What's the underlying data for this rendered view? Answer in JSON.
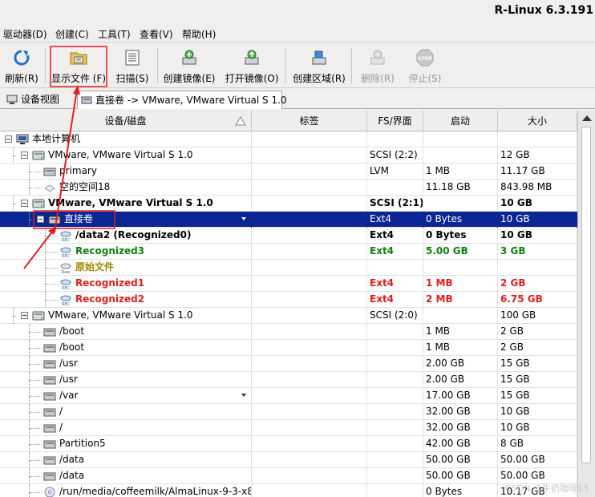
{
  "window": {
    "title": "R-Linux 6.3.191"
  },
  "menu": [
    "驱动器(D)",
    "创建(C)",
    "工具(T)",
    "查看(V)",
    "帮助(H)"
  ],
  "toolbar": [
    {
      "label": "刷新(R)",
      "icon": "refresh-icon",
      "enabled": true
    },
    {
      "label": "显示文件 (F)",
      "icon": "show-files-icon",
      "enabled": true
    },
    {
      "label": "扫描(S)",
      "icon": "scan-icon",
      "enabled": true
    },
    {
      "label": "创建镜像(E)",
      "icon": "create-image-icon",
      "enabled": true
    },
    {
      "label": "打开镜像(O)",
      "icon": "open-image-icon",
      "enabled": true
    },
    {
      "label": "创建区域(R)",
      "icon": "create-region-icon",
      "enabled": true
    },
    {
      "label": "删除(R)",
      "icon": "delete-icon",
      "enabled": false
    },
    {
      "label": "停止(S)",
      "icon": "stop-icon",
      "enabled": false
    }
  ],
  "tabs": [
    {
      "label": "设备视图",
      "icon": "device-view-icon"
    },
    {
      "label": "直接卷 -> VMware, VMware Virtual S 1.0",
      "icon": "volume-icon"
    }
  ],
  "columns": [
    "设备/磁盘",
    "标签",
    "FS/界面",
    "启动",
    "大小"
  ],
  "rows": [
    {
      "name": "本地计算机",
      "label": "",
      "fs": "",
      "start": "",
      "size": "",
      "icon": "computer-icon",
      "style": ""
    },
    {
      "name": "VMware, VMware Virtual S 1.0",
      "label": "",
      "fs": "SCSI (2:2)",
      "start": "",
      "size": "12 GB",
      "icon": "disk-icon",
      "style": ""
    },
    {
      "name": "primary",
      "label": "",
      "fs": "LVM",
      "start": "1 MB",
      "size": "11.17 GB",
      "icon": "partition-icon",
      "style": ""
    },
    {
      "name": "空的空间18",
      "label": "",
      "fs": "",
      "start": "11.18 GB",
      "size": "843.98 MB",
      "icon": "empty-space-icon",
      "style": ""
    },
    {
      "name": "VMware, VMware Virtual S 1.0",
      "label": "",
      "fs": "SCSI (2:1)",
      "start": "",
      "size": "10 GB",
      "icon": "disk-icon",
      "style": "b"
    },
    {
      "name": "直接卷",
      "label": "",
      "fs": "Ext4",
      "start": "0 Bytes",
      "size": "10 GB",
      "icon": "volume-icon",
      "style": "sel"
    },
    {
      "name": "/data2 (Recognized0)",
      "label": "",
      "fs": "Ext4",
      "start": "0 Bytes",
      "size": "10 GB",
      "icon": "recognized-icon",
      "style": "b"
    },
    {
      "name": "Recognized3",
      "label": "",
      "fs": "Ext4",
      "start": "5.00 GB",
      "size": "3 GB",
      "icon": "recognized-icon",
      "style": "green"
    },
    {
      "name": "原始文件",
      "label": "",
      "fs": "",
      "start": "",
      "size": "",
      "icon": "raw-icon",
      "style": "olive"
    },
    {
      "name": "Recognized1",
      "label": "",
      "fs": "Ext4",
      "start": "1 MB",
      "size": "2 GB",
      "icon": "recognized-icon",
      "style": "red"
    },
    {
      "name": "Recognized2",
      "label": "",
      "fs": "Ext4",
      "start": "2 MB",
      "size": "6.75 GB",
      "icon": "recognized-icon",
      "style": "red"
    },
    {
      "name": "VMware, VMware Virtual S 1.0",
      "label": "",
      "fs": "SCSI (2:0)",
      "start": "",
      "size": "100 GB",
      "icon": "disk-icon",
      "style": ""
    },
    {
      "name": "/boot",
      "label": "",
      "fs": "",
      "start": "1 MB",
      "size": "2 GB",
      "icon": "partition-icon",
      "style": ""
    },
    {
      "name": "/boot",
      "label": "",
      "fs": "",
      "start": "1 MB",
      "size": "2 GB",
      "icon": "partition-icon",
      "style": ""
    },
    {
      "name": "/usr",
      "label": "",
      "fs": "",
      "start": "2.00 GB",
      "size": "15 GB",
      "icon": "partition-icon",
      "style": ""
    },
    {
      "name": "/usr",
      "label": "",
      "fs": "",
      "start": "2.00 GB",
      "size": "15 GB",
      "icon": "partition-icon",
      "style": ""
    },
    {
      "name": "/var",
      "label": "",
      "fs": "",
      "start": "17.00 GB",
      "size": "15 GB",
      "icon": "partition-icon",
      "style": "dd"
    },
    {
      "name": "/",
      "label": "",
      "fs": "",
      "start": "32.00 GB",
      "size": "10 GB",
      "icon": "partition-icon",
      "style": ""
    },
    {
      "name": "/",
      "label": "",
      "fs": "",
      "start": "32.00 GB",
      "size": "10 GB",
      "icon": "partition-icon",
      "style": ""
    },
    {
      "name": "Partition5",
      "label": "",
      "fs": "",
      "start": "42.00 GB",
      "size": "8 GB",
      "icon": "partition-icon",
      "style": ""
    },
    {
      "name": "/data",
      "label": "",
      "fs": "",
      "start": "50.00 GB",
      "size": "50.00 GB",
      "icon": "partition-icon",
      "style": ""
    },
    {
      "name": "/data",
      "label": "",
      "fs": "",
      "start": "50.00 GB",
      "size": "50.00 GB",
      "icon": "partition-icon",
      "style": ""
    },
    {
      "name": "/run/media/coffeemilk/AlmaLinux-9-3-x8…",
      "label": "",
      "fs": "",
      "start": "0 Bytes",
      "size": "10.17 GB",
      "icon": "optical-icon",
      "style": ""
    }
  ],
  "watermark": "CSDN @牛奶咖啡13"
}
